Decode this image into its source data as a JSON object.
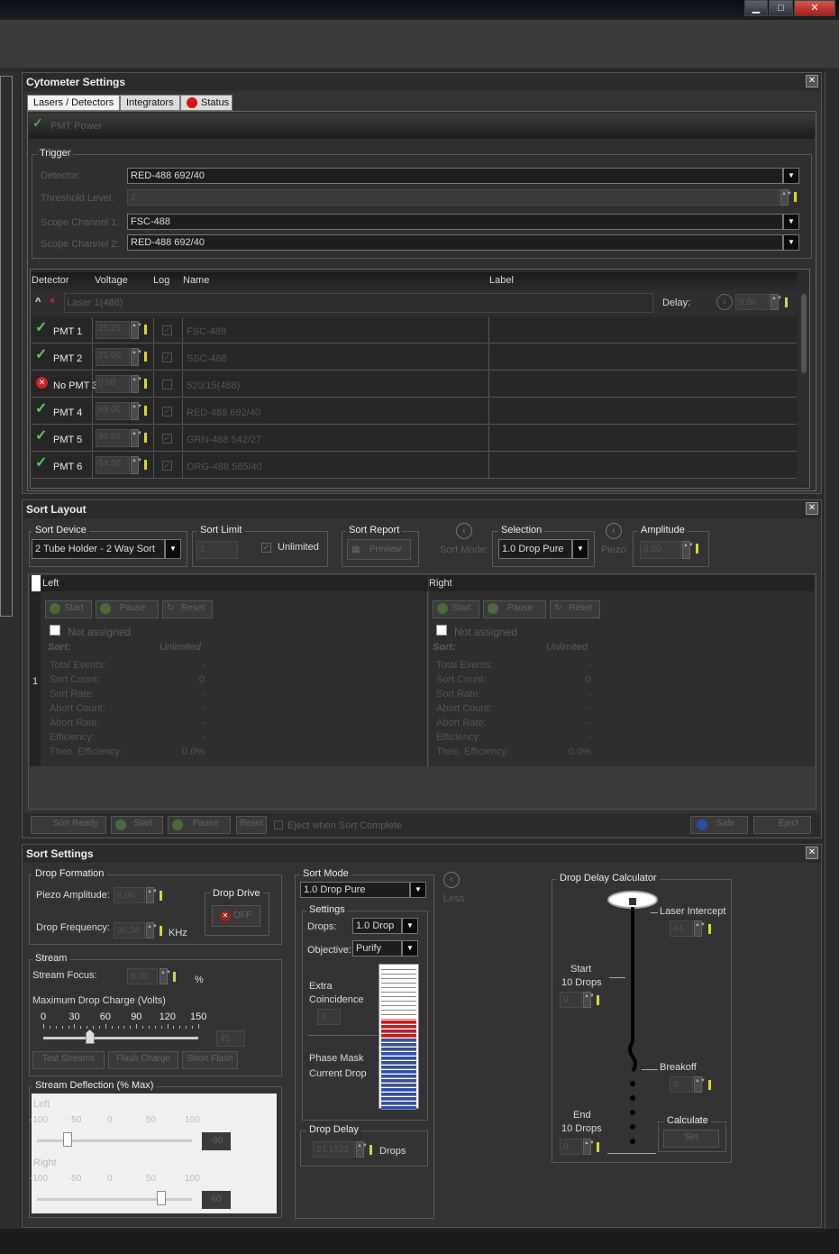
{
  "window": {
    "minimize": "▁",
    "maximize": "□",
    "close": "✕"
  },
  "cytometer": {
    "title": "Cytometer Settings",
    "tabs": [
      "Lasers / Detectors",
      "Integrators",
      "Status"
    ],
    "pmt_power": "PMT Power",
    "trigger": {
      "label": "Trigger",
      "detector_label": "Detector:",
      "detector": "RED-488 692/40",
      "threshold_label": "Threshold Level:",
      "threshold": "2",
      "scope1_label": "Scope Channel 1:",
      "scope1": "FSC-488",
      "scope2_label": "Scope Channel 2:",
      "scope2": "RED-488 692/40"
    },
    "columns": [
      "Detector",
      "Voltage",
      "Log",
      "Name",
      "Label"
    ],
    "laser": {
      "name": "Laser 1(488)",
      "delay_label": "Delay:",
      "delay": "0.00"
    },
    "rows": [
      {
        "detector": "PMT 1",
        "voltage": "25.25",
        "name": "FSC-488",
        "status": "ok"
      },
      {
        "detector": "PMT 2",
        "voltage": "25.00",
        "name": "SSC-488",
        "status": "ok"
      },
      {
        "detector": "No PMT 3",
        "voltage": "0.00",
        "name": "520/15(488)",
        "status": "error"
      },
      {
        "detector": "PMT 4",
        "voltage": "69.00",
        "name": "RED-488 692/40",
        "status": "ok"
      },
      {
        "detector": "PMT 5",
        "voltage": "50.85",
        "name": "GRN-488 542/27",
        "status": "ok"
      },
      {
        "detector": "PMT 6",
        "voltage": "54.50",
        "name": "ORG-488 585/40",
        "status": "ok"
      }
    ]
  },
  "sort_layout": {
    "title": "Sort Layout",
    "sort_device_label": "Sort Device",
    "sort_device": "2 Tube Holder - 2 Way Sort",
    "sort_limit_label": "Sort Limit",
    "sort_limit": "1",
    "unlimited": "Unlimited",
    "sort_report_label": "Sort Report",
    "preview": "Preview",
    "sort_mode": "Sort Mode:",
    "selection_label": "Selection",
    "selection": "1.0 Drop Pure",
    "piezo": "Piezo:",
    "amplitude_label": "Amplitude",
    "amplitude": "0.00",
    "row_number": "1",
    "left": {
      "title": "Left",
      "start": "Start",
      "pause": "Pause",
      "reset": "Reset",
      "not_assigned": "Not assigned"
    },
    "right": {
      "title": "Right",
      "start": "Start",
      "pause": "Pause",
      "reset": "Reset",
      "not_assigned": "Not assigned"
    },
    "sort_header": "Sort:",
    "sort_header_val": "Unlimited",
    "stats": [
      [
        "Total Events:",
        "-"
      ],
      [
        "Sort Count:",
        "0"
      ],
      [
        "Sort Rate:",
        "-"
      ],
      [
        "Abort Count:",
        "-"
      ],
      [
        "Abort Rate:",
        "-"
      ],
      [
        "Efficiency:",
        "-"
      ],
      [
        "Theo. Efficiency:",
        "0.0%"
      ]
    ],
    "bottom": {
      "sort_ready": "Sort Ready",
      "start": "Start",
      "pause": "Pause",
      "reset": "Reset",
      "eject": "Eject when Sort Complete",
      "safe": "Safe",
      "eject_btn": "Eject"
    }
  },
  "sort_settings": {
    "title": "Sort Settings",
    "drop_formation": "Drop Formation",
    "piezo_label": "Piezo Amplitude:",
    "piezo": "0.00",
    "drop_freq_label": "Drop Frequency:",
    "drop_freq": "36.58",
    "khz": "KHz",
    "drop_drive": "Drop Drive",
    "off": "OFF",
    "stream": "Stream",
    "stream_focus_label": "Stream Focus:",
    "stream_focus": "6.00",
    "percent": "%",
    "max_charge": "Maximum Drop Charge (Volts)",
    "charge_ticks": [
      "0",
      "30",
      "60",
      "90",
      "120",
      "150"
    ],
    "charge_value": "45",
    "test_streams": "Test Streams",
    "flash_charge": "Flash Charge",
    "short_flash": "Short Flash",
    "deflection": "Stream Deflection (% Max)",
    "defl_left": "Left",
    "defl_right": "Right",
    "defl_ticks": [
      "-100",
      "-50",
      "0",
      "50",
      "100"
    ],
    "defl_left_val": "-60",
    "defl_right_val": "60",
    "sort_mode_label": "Sort Mode",
    "sort_mode": "1.0 Drop Pure",
    "settings": "Settings",
    "drops_label": "Drops:",
    "drops": "1.0 Drop",
    "objective_label": "Objective:",
    "objective": "Purify",
    "extra_coincidence": "Extra\nCoincidence",
    "extra_value": "4",
    "phase_mask": "Phase Mask",
    "current_drop": "Current Drop",
    "less": "Less",
    "drop_delay_label": "Drop Delay",
    "drop_delay": "24.1522",
    "drops_unit": "Drops",
    "calc": "Drop Delay Calculator",
    "laser_intercept": "Laser Intercept",
    "laser_intercept_val": "44",
    "start_label": "Start",
    "start_drops": "10 Drops",
    "start_val": "0",
    "breakoff": "Breakoff",
    "breakoff_val": "0",
    "end_label": "End",
    "end_drops": "10 Drops",
    "end_val": "0",
    "calculate": "Calculate",
    "set": "Set"
  },
  "colors": {
    "accent_green": "#55cc55",
    "error_red": "#cc2222",
    "yellow": "#d9d43a",
    "phase_blue": "#2f4fae",
    "phase_red": "#e01010"
  }
}
